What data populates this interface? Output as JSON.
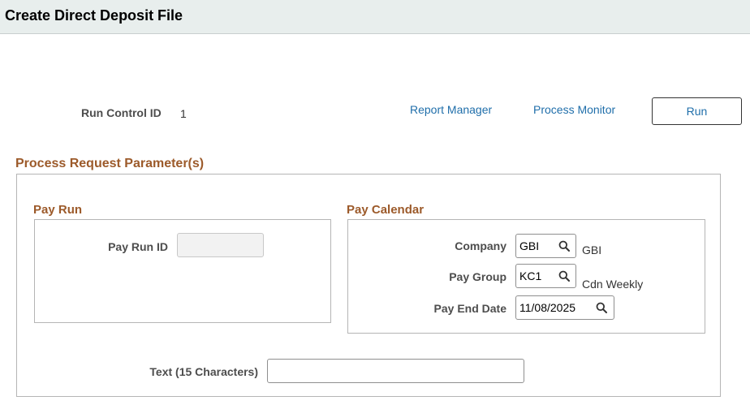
{
  "header": {
    "title": "Create Direct Deposit File"
  },
  "run_control": {
    "label": "Run Control ID",
    "value": "1"
  },
  "toolbar": {
    "report_manager": "Report Manager",
    "process_monitor": "Process Monitor",
    "run_button": "Run"
  },
  "parameters": {
    "title": "Process Request Parameter(s)",
    "pay_run": {
      "title": "Pay Run",
      "pay_run_id_label": "Pay Run ID",
      "pay_run_id_value": ""
    },
    "pay_calendar": {
      "title": "Pay Calendar",
      "company_label": "Company",
      "company_value": "GBI",
      "company_desc": "GBI",
      "pay_group_label": "Pay Group",
      "pay_group_value": "KC1",
      "pay_group_desc": "Cdn Weekly",
      "pay_end_date_label": "Pay End Date",
      "pay_end_date_value": "11/08/2025"
    },
    "text_label": "Text (15 Characters)",
    "text_value": ""
  },
  "icons": {
    "lookup": "search-icon"
  },
  "colors": {
    "link": "#1f6eaa",
    "section_title": "#9c5a2a",
    "header_bg": "#e8eeed"
  }
}
